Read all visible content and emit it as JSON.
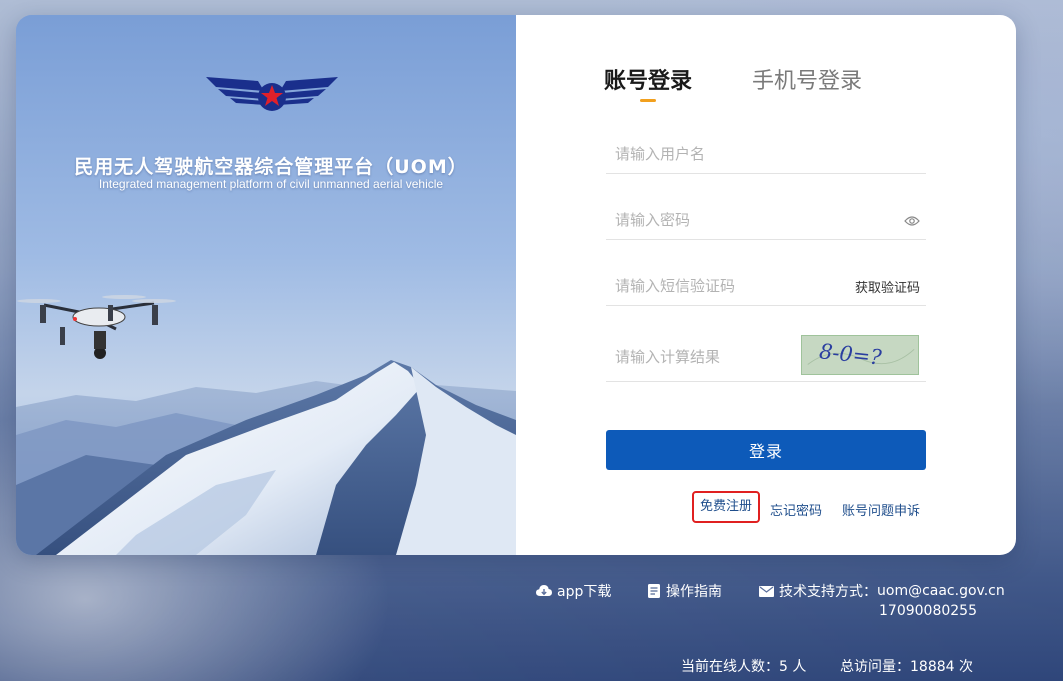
{
  "hero": {
    "title": "民用无人驾驶航空器综合管理平台（UOM）",
    "subtitle": "Integrated management platform of civil unmanned aerial vehicle"
  },
  "tabs": {
    "account": "账号登录",
    "phone": "手机号登录"
  },
  "fields": {
    "username_placeholder": "请输入用户名",
    "password_placeholder": "请输入密码",
    "sms_placeholder": "请输入短信验证码",
    "sms_button": "获取验证码",
    "calc_placeholder": "请输入计算结果",
    "captcha_text": "8-0=?"
  },
  "login_button": "登录",
  "links": {
    "register": "免费注册",
    "forgot": "忘记密码",
    "appeal": "账号问题申诉"
  },
  "footer": {
    "app_download": "app下载",
    "guide": "操作指南",
    "support_label": "技术支持方式：",
    "support_email": "uom@caac.gov.cn",
    "support_phone": "17090080255",
    "online_label": "当前在线人数：",
    "online_count": "5",
    "online_unit": "人",
    "visits_label": "总访问量：",
    "visits_count": "18884",
    "visits_unit": "次"
  },
  "colors": {
    "primary": "#0d5ab9",
    "tab_accent": "#f2a01e",
    "highlight_border": "#e02020",
    "link": "#1f4e8c"
  },
  "icons": {
    "eye": "eye-icon",
    "cloud_download": "cloud-download-icon",
    "document": "document-icon",
    "mail": "mail-icon",
    "logo": "caac-wings-logo"
  }
}
